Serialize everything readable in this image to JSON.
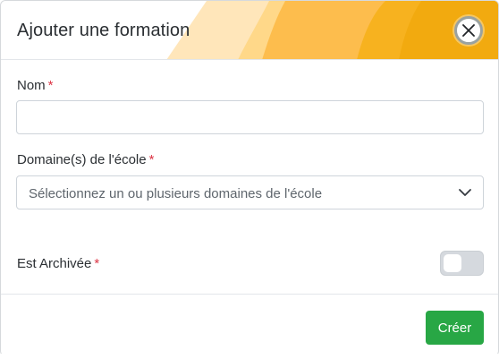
{
  "modal": {
    "title": "Ajouter une formation",
    "close_icon": "close-icon"
  },
  "form": {
    "name": {
      "label": "Nom",
      "required_mark": "*",
      "value": "",
      "placeholder": ""
    },
    "domains": {
      "label": "Domaine(s) de l'école",
      "required_mark": "*",
      "placeholder": "Sélectionnez un ou plusieurs domaines de l'école",
      "icon": "chevron-down-icon"
    },
    "archived": {
      "label": "Est Archivée",
      "required_mark": "*",
      "checked": false
    }
  },
  "footer": {
    "submit_label": "Créer"
  },
  "colors": {
    "header_gradient": [
      "#ffe7b8",
      "#fdbf45",
      "#f2ab12"
    ],
    "submit_button": "#28a745",
    "required": "#dc3545",
    "toggle_off": "#d5d9de"
  }
}
